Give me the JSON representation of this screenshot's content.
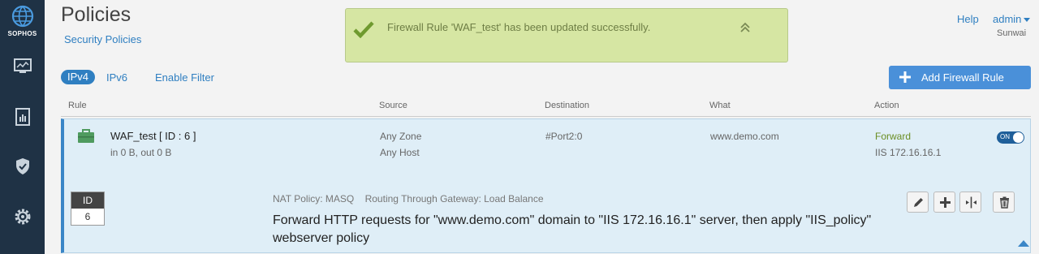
{
  "brand": {
    "name": "SOPHOS"
  },
  "nav": {
    "items": [
      {
        "icon": "monitor-icon"
      },
      {
        "icon": "report-icon"
      },
      {
        "icon": "shield-check-icon"
      },
      {
        "icon": "settings-gear-icon"
      }
    ]
  },
  "header": {
    "title": "Policies",
    "breadcrumb": "Security Policies",
    "help": "Help",
    "user": "admin",
    "org": "Sunwai"
  },
  "toast": {
    "message": "Firewall Rule 'WAF_test' has been updated successfully.",
    "icon": "check-icon"
  },
  "filters": {
    "ipv4": "IPv4",
    "ipv6": "IPv6",
    "enable_filter": "Enable Filter"
  },
  "add_button": {
    "label": "Add Firewall Rule"
  },
  "columns": {
    "rule": "Rule",
    "source": "Source",
    "destination": "Destination",
    "what": "What",
    "action": "Action"
  },
  "rule": {
    "name": "WAF_test",
    "id_label": "[ ID : 6 ]",
    "traffic": "in 0 B, out 0 B",
    "source_zone": "Any Zone",
    "source_host": "Any Host",
    "destination": "#Port2:0",
    "what": "www.demo.com",
    "action": "Forward",
    "action_target": "IIS 172.16.16.1",
    "toggle": "ON",
    "id_head": "ID",
    "id_value": "6",
    "nat_policy": "NAT Policy: MASQ",
    "routing": "Routing Through Gateway: Load Balance",
    "description": "Forward HTTP requests for \"www.demo.com\" domain to \"IIS 172.16.16.1\" server, then apply \"IIS_policy\" webserver policy"
  },
  "colors": {
    "rail": "#1f3245",
    "accent": "#2f7fc1",
    "toast_bg": "#d6e6a3",
    "row_bg": "#dfeef7"
  }
}
